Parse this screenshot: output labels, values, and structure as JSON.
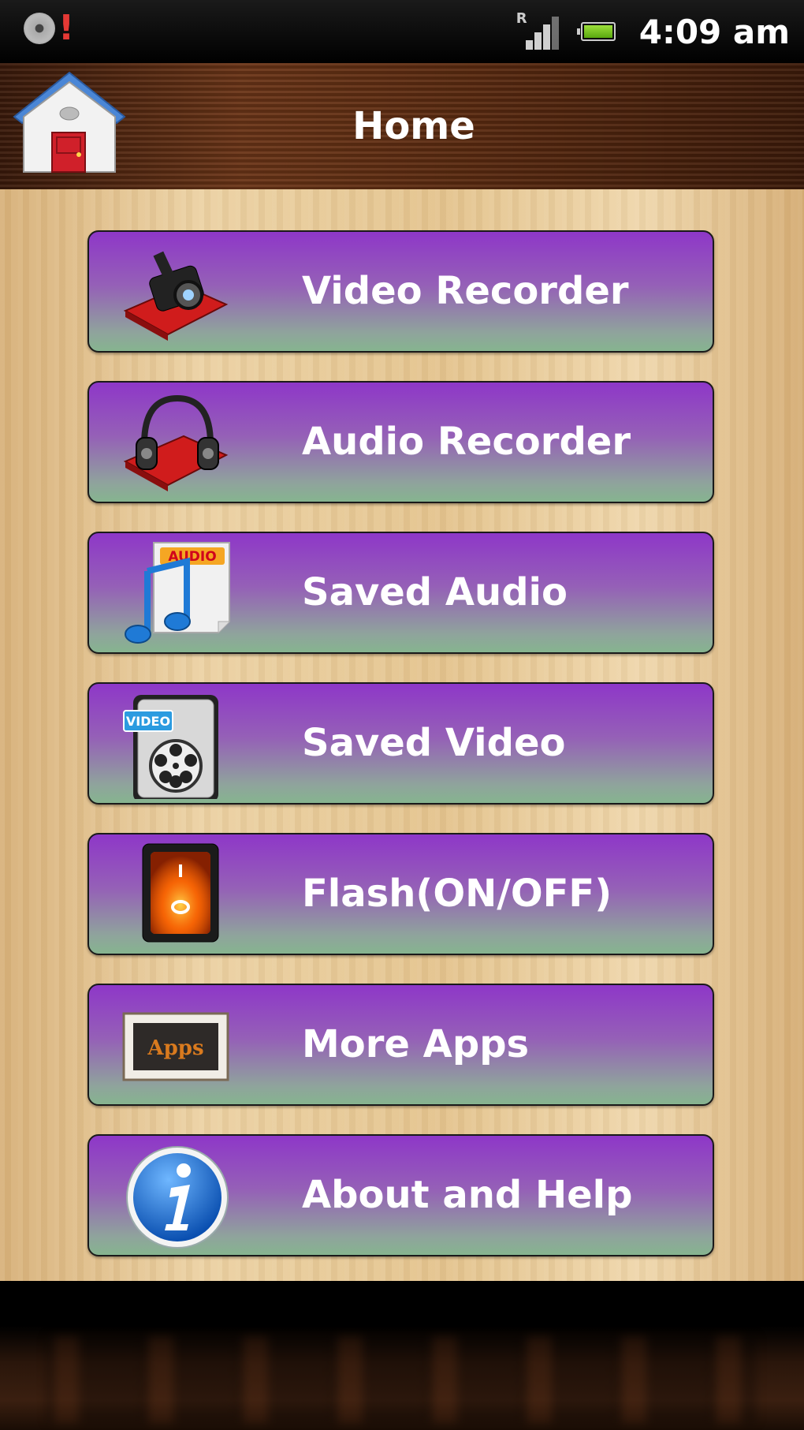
{
  "status_bar": {
    "time": "4:09 am",
    "network_label": "R",
    "left_icons": [
      "disc-icon",
      "alert-icon"
    ],
    "alert_glyph": "!",
    "battery_color": "#7ccf27"
  },
  "header": {
    "title": "Home",
    "icon": "house-icon"
  },
  "menu": {
    "items": [
      {
        "label": "Video Recorder",
        "icon": "video-camera-icon"
      },
      {
        "label": "Audio Recorder",
        "icon": "headphones-icon"
      },
      {
        "label": "Saved Audio",
        "icon": "audio-file-icon"
      },
      {
        "label": "Saved Video",
        "icon": "video-file-icon"
      },
      {
        "label": "Flash(ON/OFF)",
        "icon": "power-switch-icon"
      },
      {
        "label": "More Apps",
        "icon": "apps-frame-icon"
      },
      {
        "label": "About and Help",
        "icon": "info-icon"
      }
    ]
  },
  "colors": {
    "button_top": "#8e37c8",
    "button_bottom": "#86b48f",
    "header_wood": "#5a2a10",
    "panel_wood": "#e4c48f"
  }
}
